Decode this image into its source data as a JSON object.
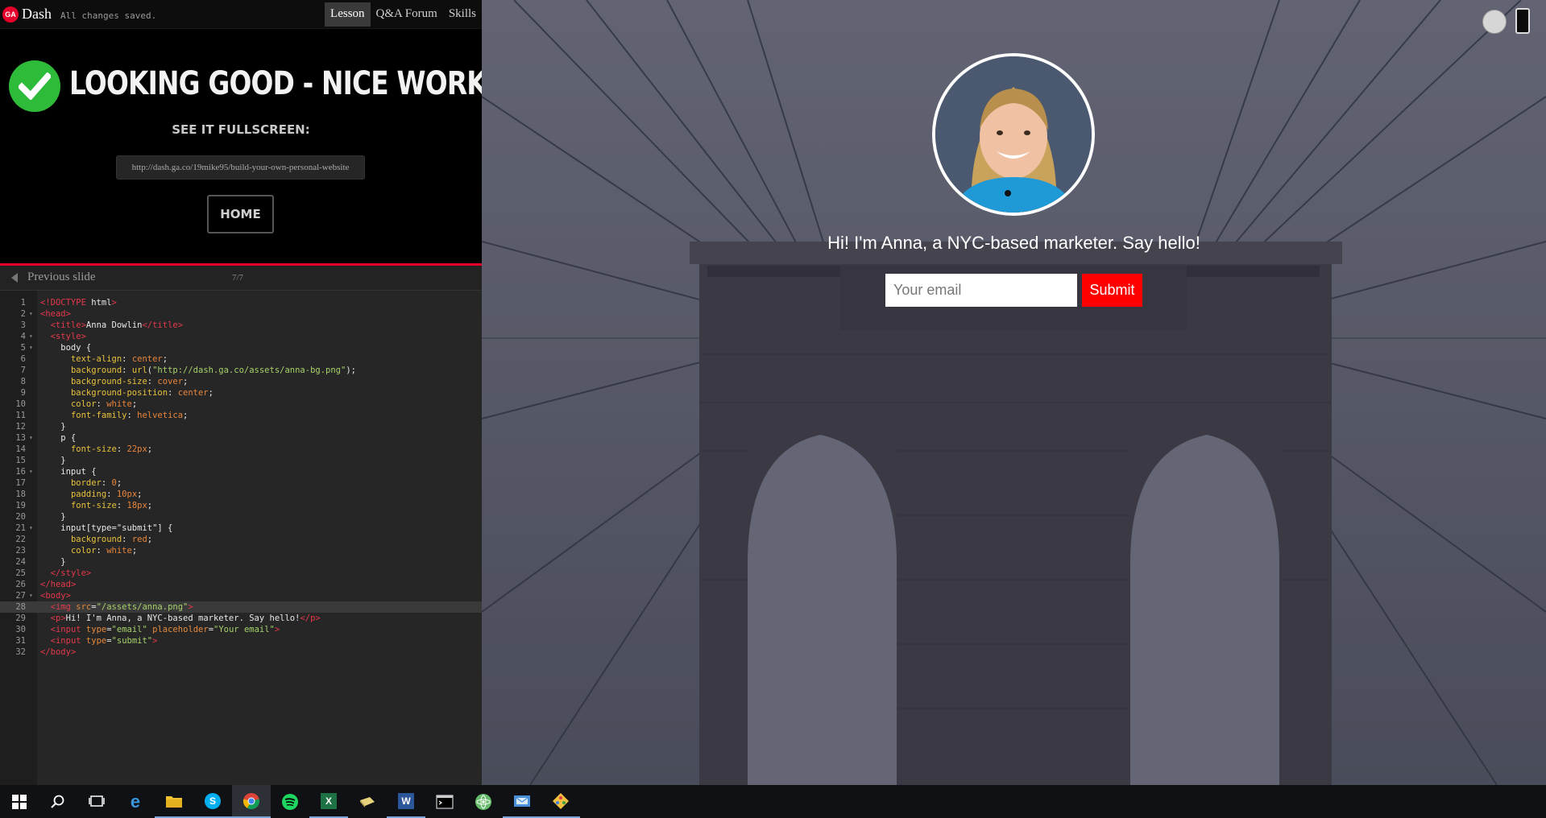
{
  "topbar": {
    "logo_text": "GA",
    "app_name": "Dash",
    "save_status": "All changes saved.",
    "tabs": [
      {
        "label": "Lesson",
        "active": true
      },
      {
        "label": "Q&A Forum",
        "active": false
      },
      {
        "label": "Skills",
        "active": false
      }
    ]
  },
  "lesson": {
    "heading": "LOOKING GOOD - NICE WORK!",
    "fullscreen_label": "SEE IT FULLSCREEN:",
    "share_url": "http://dash.ga.co/19mike95/build-your-own-personal-website",
    "home_label": "HOME",
    "prev_slide_label": "Previous slide",
    "slide_counter": "7/7"
  },
  "editor": {
    "lines": [
      {
        "n": "1",
        "text": "<!DOCTYPE html>"
      },
      {
        "n": "2",
        "text": "<head>",
        "fold": true
      },
      {
        "n": "3",
        "text": "  <title>Anna Dowlin</title>"
      },
      {
        "n": "4",
        "text": "  <style>",
        "fold": true
      },
      {
        "n": "5",
        "text": "    body {",
        "fold": true
      },
      {
        "n": "6",
        "text": "      text-align: center;"
      },
      {
        "n": "7",
        "text": "      background: url(\"http://dash.ga.co/assets/anna-bg.png\");"
      },
      {
        "n": "8",
        "text": "      background-size: cover;"
      },
      {
        "n": "9",
        "text": "      background-position: center;"
      },
      {
        "n": "10",
        "text": "      color: white;"
      },
      {
        "n": "11",
        "text": "      font-family: helvetica;"
      },
      {
        "n": "12",
        "text": "    }"
      },
      {
        "n": "13",
        "text": "    p {",
        "fold": true
      },
      {
        "n": "14",
        "text": "      font-size: 22px;"
      },
      {
        "n": "15",
        "text": "    }"
      },
      {
        "n": "16",
        "text": "    input {",
        "fold": true
      },
      {
        "n": "17",
        "text": "      border: 0;"
      },
      {
        "n": "18",
        "text": "      padding: 10px;"
      },
      {
        "n": "19",
        "text": "      font-size: 18px;"
      },
      {
        "n": "20",
        "text": "    }"
      },
      {
        "n": "21",
        "text": "    input[type=\"submit\"] {",
        "fold": true
      },
      {
        "n": "22",
        "text": "      background: red;"
      },
      {
        "n": "23",
        "text": "      color: white;"
      },
      {
        "n": "24",
        "text": "    }"
      },
      {
        "n": "25",
        "text": "  </style>"
      },
      {
        "n": "26",
        "text": "</head>"
      },
      {
        "n": "27",
        "text": "<body>",
        "fold": true
      },
      {
        "n": "28",
        "text": "  <img src=\"/assets/anna.png\">",
        "highlight": true
      },
      {
        "n": "29",
        "text": "  <p>Hi! I'm Anna, a NYC-based marketer. Say hello!</p>"
      },
      {
        "n": "30",
        "text": "  <input type=\"email\" placeholder=\"Your email\">"
      },
      {
        "n": "31",
        "text": "  <input type=\"submit\">"
      },
      {
        "n": "32",
        "text": "</body>"
      }
    ]
  },
  "preview": {
    "hello_text": "Hi! I'm Anna, a NYC-based marketer. Say hello!",
    "email_placeholder": "Your email",
    "submit_label": "Submit"
  },
  "taskbar": {
    "icons": [
      {
        "name": "start-icon",
        "state": "normal"
      },
      {
        "name": "search-icon",
        "state": "normal"
      },
      {
        "name": "task-view-icon",
        "state": "normal"
      },
      {
        "name": "edge-icon",
        "state": "normal"
      },
      {
        "name": "file-explorer-icon",
        "state": "open"
      },
      {
        "name": "skype-icon",
        "state": "open"
      },
      {
        "name": "chrome-icon",
        "state": "active"
      },
      {
        "name": "spotify-icon",
        "state": "normal"
      },
      {
        "name": "excel-icon",
        "state": "open"
      },
      {
        "name": "notes-icon",
        "state": "normal"
      },
      {
        "name": "word-icon",
        "state": "open"
      },
      {
        "name": "terminal-icon",
        "state": "normal"
      },
      {
        "name": "atom-icon",
        "state": "normal"
      },
      {
        "name": "outlook-icon",
        "state": "open"
      },
      {
        "name": "git-icon",
        "state": "open"
      }
    ]
  },
  "colors": {
    "accent_red": "#e4002b",
    "success_green": "#2ebb3a",
    "submit_red": "#ff0000"
  }
}
